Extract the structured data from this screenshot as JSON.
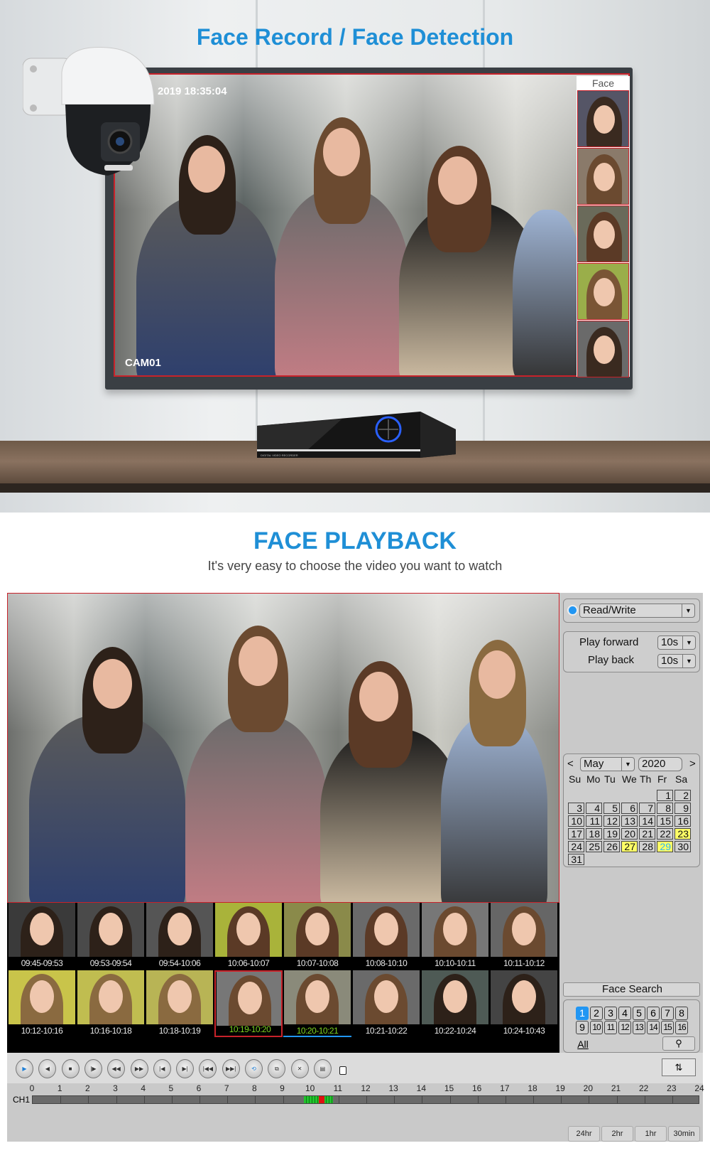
{
  "top": {
    "title": "Face Record / Face Detection",
    "timestamp": "2019 18:35:04",
    "camera_label": "CAM01",
    "face_panel_label": "Face",
    "dvr_label": "DIGITAL VIDEO RECORDER"
  },
  "playback": {
    "title": "FACE PLAYBACK",
    "subtitle": "It's very easy to choose the video you want to watch"
  },
  "thumbnails": [
    {
      "time": "09:45-09:53"
    },
    {
      "time": "09:53-09:54"
    },
    {
      "time": "09:54-10:06"
    },
    {
      "time": "10:06-10:07"
    },
    {
      "time": "10:07-10:08"
    },
    {
      "time": "10:08-10:10"
    },
    {
      "time": "10:10-10:11"
    },
    {
      "time": "10:11-10:12"
    },
    {
      "time": "10:12-10:16"
    },
    {
      "time": "10:16-10:18"
    },
    {
      "time": "10:18-10:19"
    },
    {
      "time": "10:19-10:20",
      "state": "selected-red"
    },
    {
      "time": "10:20-10:21",
      "state": "selected-blue"
    },
    {
      "time": "10:21-10:22"
    },
    {
      "time": "10:22-10:24"
    },
    {
      "time": "10:24-10:43"
    }
  ],
  "side": {
    "mode": "Read/Write",
    "play_forward_label": "Play forward",
    "play_forward_value": "10s",
    "play_back_label": "Play back",
    "play_back_value": "10s",
    "calendar": {
      "prev": "<",
      "next": ">",
      "month": "May",
      "year": "2020",
      "weekdays": [
        "Su",
        "Mo",
        "Tu",
        "We",
        "Th",
        "Fr",
        "Sa"
      ],
      "first_weekday": 5,
      "days": 31,
      "highlighted": [
        23,
        27,
        29
      ],
      "current": 29
    },
    "face_search_label": "Face Search",
    "channels": [
      "1",
      "2",
      "3",
      "4",
      "5",
      "6",
      "7",
      "8",
      "9",
      "10",
      "11",
      "12",
      "13",
      "14",
      "15",
      "16"
    ],
    "active_channel": "1",
    "all_label": "All"
  },
  "controls": [
    "play",
    "reverse-play",
    "stop",
    "step-forward",
    "rewind",
    "fast-forward",
    "prev-frame",
    "next-frame",
    "skip-start",
    "skip-end",
    "loop",
    "copy",
    "cut",
    "save"
  ],
  "timeline": {
    "channel": "CH1",
    "hours": [
      "0",
      "1",
      "2",
      "3",
      "4",
      "5",
      "6",
      "7",
      "8",
      "9",
      "10",
      "11",
      "12",
      "13",
      "14",
      "15",
      "16",
      "17",
      "18",
      "19",
      "20",
      "21",
      "22",
      "23",
      "24"
    ],
    "recordings": [
      {
        "start": 9.75,
        "end": 10.8,
        "color": "#22c32e"
      },
      {
        "start": 10.3,
        "end": 10.5,
        "color": "#e01010"
      }
    ],
    "zoom_options": [
      "24hr",
      "2hr",
      "1hr",
      "30min"
    ]
  },
  "colors": {
    "accent": "#1f8fd6",
    "border_red": "#c8222a",
    "selected_blue": "#2196f3",
    "timestamp_green": "#7ed321"
  }
}
